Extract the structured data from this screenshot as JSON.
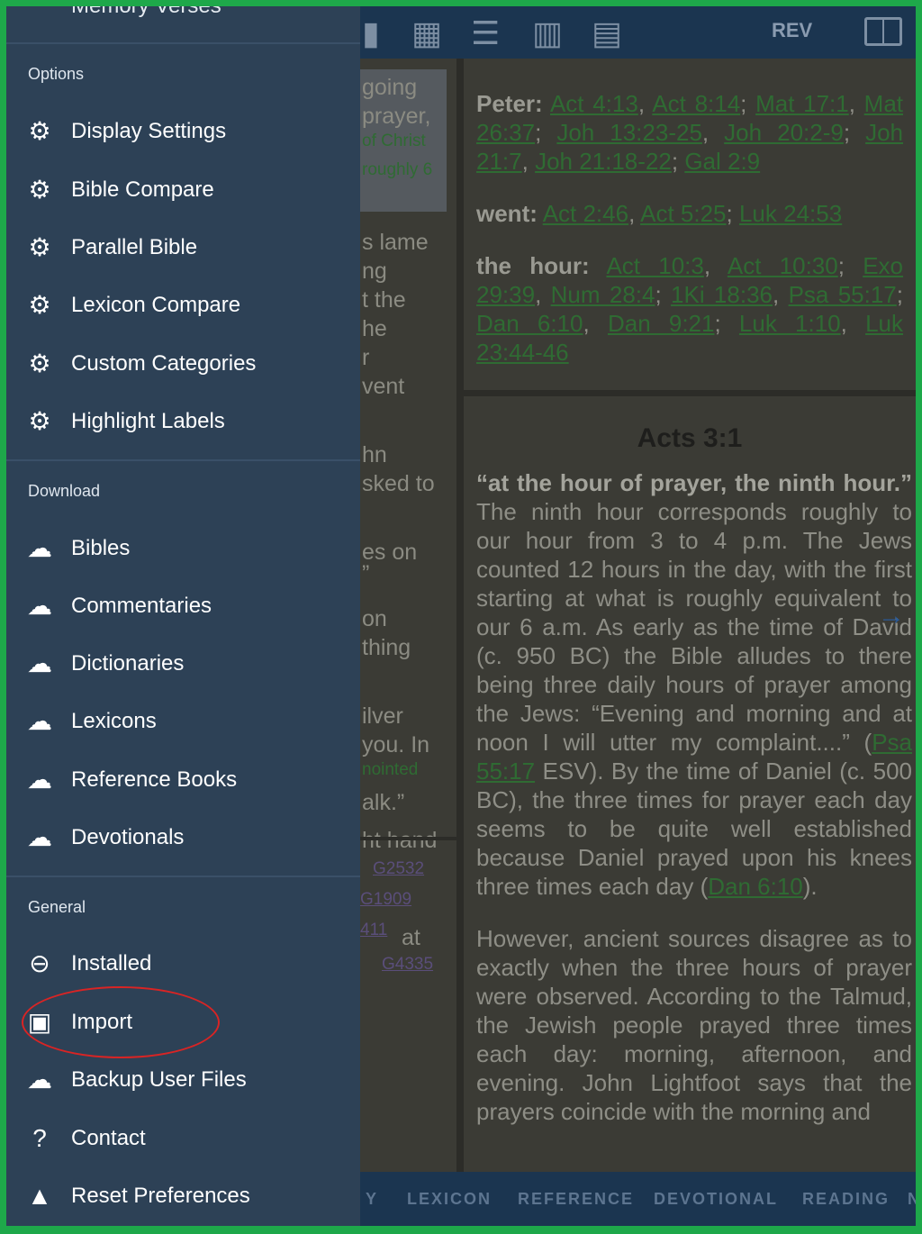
{
  "toolbar": {
    "version_label": "REV"
  },
  "left_pane": {
    "lines": [
      "going",
      "prayer,",
      "of Christ",
      "roughly 6",
      "s lame",
      "ng",
      "t the",
      "he",
      "r",
      "vent",
      "hn",
      "sked to",
      "es on",
      "”",
      "on",
      "thing",
      "ilver",
      "you. In",
      "nointed",
      "alk.”",
      "ht hand",
      "G2532",
      "G1909",
      "411",
      "at",
      "G4335"
    ]
  },
  "refs": {
    "groups": [
      {
        "label": "Peter:",
        "links": [
          "Act 4:13",
          "Act 8:14",
          "Mat 17:1",
          "Mat 26:37",
          "Joh 13:23-25",
          "Joh 20:2-9",
          "Joh 21:7",
          "Joh 21:18-22",
          "Gal 2:9"
        ]
      },
      {
        "label": "went:",
        "links": [
          "Act 2:46",
          "Act 5:25",
          "Luk 24:53"
        ]
      },
      {
        "label": "the hour:",
        "links": [
          "Act 10:3",
          "Act 10:30",
          "Exo 29:39",
          "Num 28:4",
          "1Ki 18:36",
          "Psa 55:17",
          "Dan 6:10",
          "Dan 9:21",
          "Luk 1:10",
          "Luk 23:44-46"
        ]
      }
    ]
  },
  "commentary": {
    "title": "Acts 3:1",
    "quote": "“at the hour of prayer, the ninth hour.”",
    "p1_a": "The ninth hour corresponds roughly to our hour from 3 to 4 p.m. The Jews counted 12 hours in the day, with the first starting at what is roughly equivalent to our 6 a.m. As early as the time of David (c. 950 BC) the Bible alludes to there being three daily hours of prayer among the Jews: “Evening and morning and at noon I will utter my complaint....” (",
    "p1_link1": "Psa 55:17",
    "p1_b": " ESV). By the time of Daniel (c. 500 BC), the three times for prayer each day seems to be quite well established because Daniel prayed upon his knees three times each day (",
    "p1_link2": "Dan 6:10",
    "p1_c": ").",
    "p2": "However, ancient sources disagree as to exactly when the three hours of prayer were observed. According to the Talmud, the Jewish people prayed three times each day: morning, afternoon, and evening. John Lightfoot says that the prayers coincide with the morning and"
  },
  "bottom_tabs": [
    "Y",
    "LEXICON",
    "REFERENCE",
    "DEVOTIONAL",
    "READING",
    "N"
  ],
  "drawer": {
    "top_item": "Memory Verses",
    "sections": {
      "options": {
        "title": "Options",
        "items": [
          "Display Settings",
          "Bible Compare",
          "Parallel Bible",
          "Lexicon Compare",
          "Custom Categories",
          "Highlight Labels"
        ]
      },
      "download": {
        "title": "Download",
        "items": [
          "Bibles",
          "Commentaries",
          "Dictionaries",
          "Lexicons",
          "Reference Books",
          "Devotionals"
        ]
      },
      "general": {
        "title": "General",
        "items": [
          "Installed",
          "Import",
          "Backup User Files",
          "Contact",
          "Reset Preferences"
        ]
      }
    }
  },
  "colors": {
    "accent_green": "#1ea84a",
    "drawer_bg": "#2d4156",
    "annotation_red": "#d92424"
  }
}
